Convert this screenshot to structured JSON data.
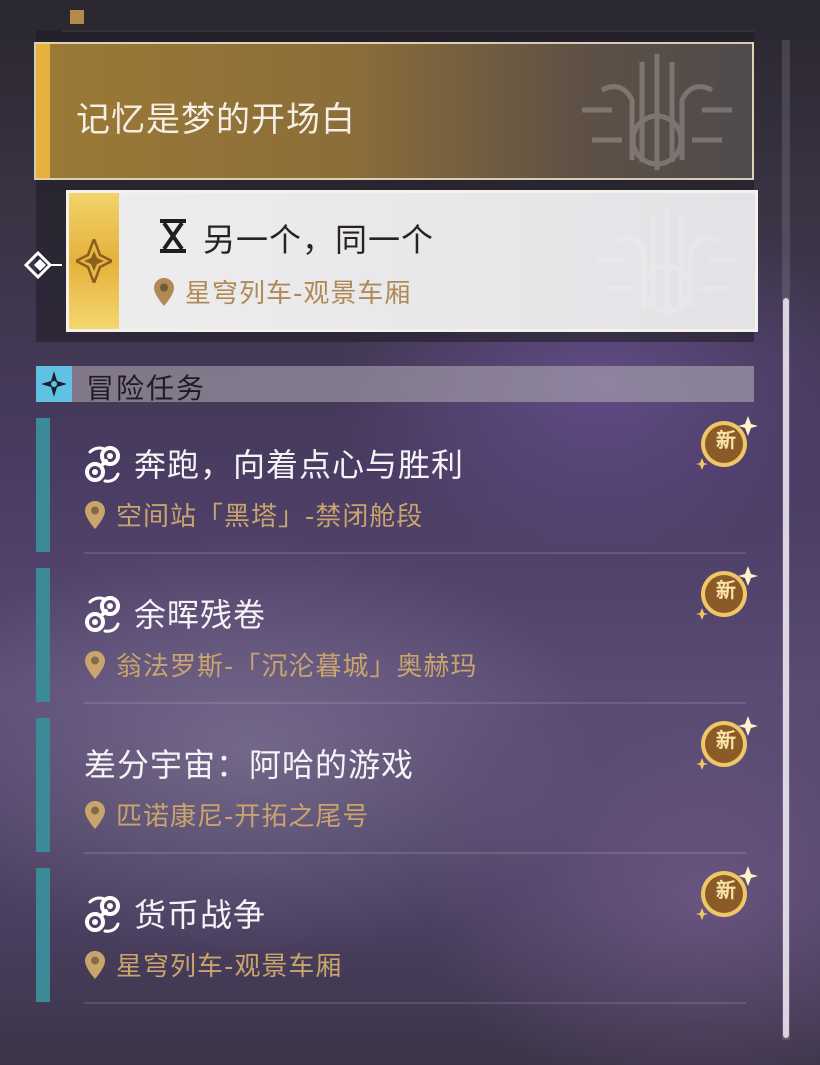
{
  "main_quest": {
    "title": "记忆是梦的开场白",
    "accent_color": "#e6b13c"
  },
  "tracked_quest": {
    "title": "另一个，同一个",
    "location": "星穹列车-观景车厢",
    "icon": "hourglass-icon"
  },
  "section": {
    "label": "冒险任务",
    "icon": "four-point-star-icon",
    "icon_color": "#5fc1e4"
  },
  "quests": [
    {
      "title": "奔跑，向着点心与胜利",
      "location": "空间站「黑塔」-禁闭舱段",
      "badge": "新",
      "has_icon": true
    },
    {
      "title": "余晖残卷",
      "location": "翁法罗斯-「沉沦暮城」奥赫玛",
      "badge": "新",
      "has_icon": true
    },
    {
      "title": "差分宇宙：阿哈的游戏",
      "location": "匹诺康尼-开拓之尾号",
      "badge": "新",
      "has_icon": false
    },
    {
      "title": "货币战争",
      "location": "星穹列车-观景车厢",
      "badge": "新",
      "has_icon": true
    }
  ]
}
